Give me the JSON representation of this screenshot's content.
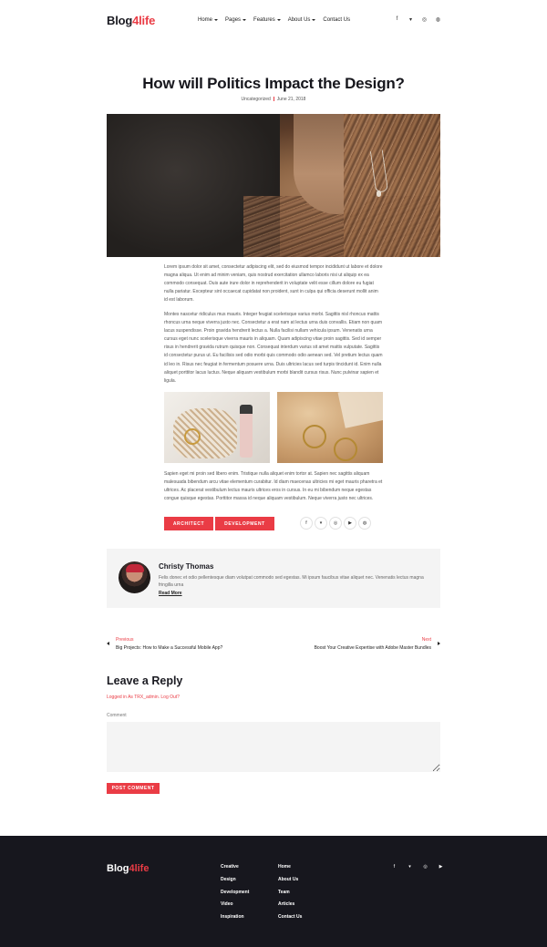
{
  "brand": {
    "name_main": "Blog",
    "name_accent": "4life",
    "accent_color": "#ea3c45"
  },
  "nav": {
    "items": [
      {
        "label": "Home",
        "has_dropdown": true
      },
      {
        "label": "Pages",
        "has_dropdown": true
      },
      {
        "label": "Features",
        "has_dropdown": true
      },
      {
        "label": "About Us",
        "has_dropdown": true
      },
      {
        "label": "Contact Us",
        "has_dropdown": false
      }
    ]
  },
  "header_social": [
    {
      "icon": "facebook-icon",
      "glyph": "f"
    },
    {
      "icon": "twitter-icon",
      "glyph": "▾"
    },
    {
      "icon": "instagram-icon",
      "glyph": "◎"
    },
    {
      "icon": "dribbble-icon",
      "glyph": "◍"
    }
  ],
  "post": {
    "title": "How will Politics Impact the Design?",
    "category": "Uncategorized",
    "date": "June 21, 2018",
    "paragraph1": "Lorem ipsum dolor sit amet, consectetur adipiscing elit, sed do eiusmod tempor incididunt ut labore et dolore magna aliqua. Ut enim ad minim veniam, quis nostrud exercitation ullamco laboris nisi ut aliquip ex ea commodo consequat. Duis aute irure dolor in reprehenderit in voluptate velit esse cillum dolore eu fugiat nulla pariatur. Excepteur sint occaecat cupidatat non proident, sunt in culpa qui officia deserunt mollit anim id est laborum.",
    "paragraph2": "Montes nascetur ridiculus mus mauris. Integer feugiat scelerisque varius morbi. Sagittis nisl rhoncus mattis rhoncus urna neque viverra justo nec. Consectetur a erat nam at lectus urna duis convallis. Etiam non quam lacus suspendisse. Proin gravida hendrerit lectus a. Nulla facilisi nullam vehicula ipsum. Venenatis urna cursus eget nunc scelerisque viverra mauris in aliquam. Quam adipiscing vitae proin sagittis. Sed id semper risus in hendrerit gravida rutrum quisque non. Consequat interdum varius sit amet mattis vulputate. Sagittis id consectetur purus ut. Eu facilisis sed odio morbi quis commodo odio aenean sed. Vel pretium lectus quam id leo in. Risus nec feugiat in fermentum posuere urna. Duis ultricies lacus sed turpis tincidunt id. Enim nulla aliquet porttitor lacus luctus. Neque aliquam vestibulum morbi blandit cursus risus. Nunc pulvinar sapien et ligula.",
    "paragraph3": "Sapien eget mi proin sed libero enim. Tristique nulla aliquet enim tortor at. Sapien nec sagittis aliquam malesuada bibendum arcu vitae elementum curabitur. Id diam maecenas ultricies mi eget mauris pharetra et ultrices. Ac placerat vestibulum lectus mauris ultrices eros in cursus. In eu mi bibendum neque egestas congue quisque egestas. Porttitor massa id neque aliquam vestibulum. Neque viverra justo nec ultrices.",
    "tags": [
      "ARCHITECT",
      "DEVELOPMENT"
    ],
    "share_icons": [
      {
        "icon": "facebook-icon",
        "glyph": "f"
      },
      {
        "icon": "twitter-icon",
        "glyph": "▾"
      },
      {
        "icon": "instagram-icon",
        "glyph": "◎"
      },
      {
        "icon": "youtube-icon",
        "glyph": "▶"
      },
      {
        "icon": "dribbble-icon",
        "glyph": "◍"
      }
    ]
  },
  "author": {
    "name": "Christy Thomas",
    "bio": "Felis donec et odio pellentesque diam volutpat commodo sed egestas. Mi ipsum faucibus vitae aliquet nec. Venenatis lectus magna fringilla urna",
    "read_more": "Read More"
  },
  "post_nav": {
    "prev_label": "Previous",
    "prev_title": "Big Projects: How to Make a Successful Mobile App?",
    "next_label": "Next",
    "next_title": "Boost Your Creative Expertise with Adobe Master Bundles"
  },
  "comments": {
    "heading": "Leave a Reply",
    "logged_in": "Logged in As TRX_admin. Log Out?",
    "comment_label": "Comment",
    "submit": "POST COMMENT"
  },
  "footer": {
    "col1": [
      "Creative",
      "Design",
      "Development",
      "Video",
      "Inspiration"
    ],
    "col2": [
      "Home",
      "About Us",
      "Team",
      "Articles",
      "Contact Us"
    ],
    "social": [
      {
        "icon": "facebook-icon",
        "glyph": "f"
      },
      {
        "icon": "twitter-icon",
        "glyph": "▾"
      },
      {
        "icon": "instagram-icon",
        "glyph": "◎"
      },
      {
        "icon": "youtube-icon",
        "glyph": "▶"
      }
    ]
  }
}
